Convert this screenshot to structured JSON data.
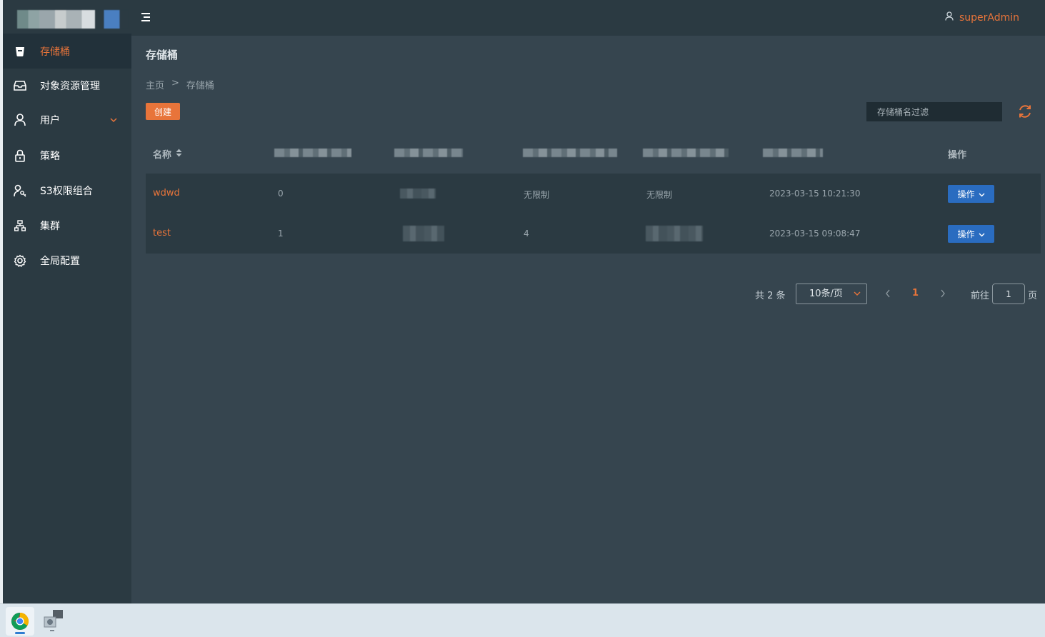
{
  "header": {
    "user_name": "superAdmin"
  },
  "sidebar": {
    "items": [
      {
        "label": "存储桶",
        "icon": "bucket-icon"
      },
      {
        "label": "对象资源管理",
        "icon": "archive-icon"
      },
      {
        "label": "用户",
        "icon": "user-icon"
      },
      {
        "label": "策略",
        "icon": "lock-icon"
      },
      {
        "label": "S3权限组合",
        "icon": "user-key-icon"
      },
      {
        "label": "集群",
        "icon": "cluster-icon"
      },
      {
        "label": "全局配置",
        "icon": "gear-icon"
      }
    ]
  },
  "page": {
    "title": "存储桶",
    "breadcrumb": [
      "主页",
      ">",
      "存储桶"
    ]
  },
  "toolbar": {
    "create_label": "创建",
    "filter_placeholder": "存储桶名过滤"
  },
  "table": {
    "headers": {
      "name": "名称",
      "actions": "操作"
    },
    "rows": [
      {
        "name": "wdwd",
        "col2": "0",
        "col4": "无限制",
        "col5": "无限制",
        "created": "2023-03-15 10:21:30",
        "action": "操作"
      },
      {
        "name": "test",
        "col2": "1",
        "col4": "4",
        "col5": "",
        "created": "2023-03-15 09:08:47",
        "action": "操作"
      }
    ]
  },
  "pagination": {
    "total": "共 2 条",
    "page_size": "10条/页",
    "current_page": "1",
    "goto_label": "前往",
    "goto_value": "1",
    "page_unit": "页"
  },
  "colors": {
    "accent": "#e8743a",
    "primary": "#2a6cc0",
    "sidebar_bg": "#2b3a42",
    "content_bg": "#36454f"
  }
}
